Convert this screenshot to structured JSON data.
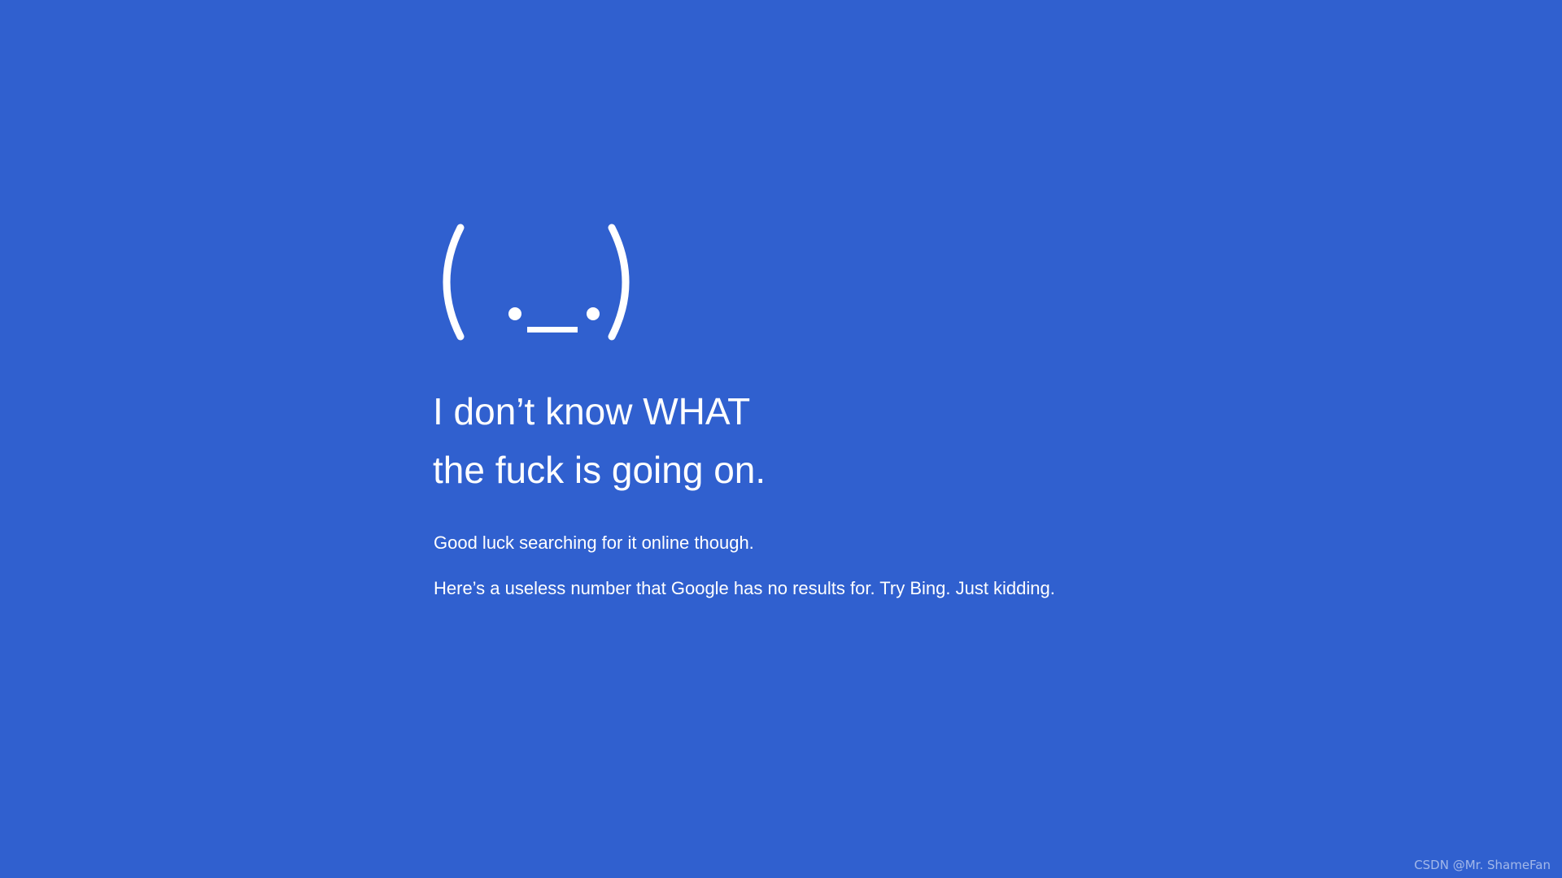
{
  "screen": {
    "background_color": "#3060cf",
    "text_color": "#ffffff"
  },
  "emoticon": {
    "icon": "sad-face-emoticon",
    "text": "( ._.)"
  },
  "headline": {
    "line1": "I don’t know WHAT",
    "line2": "the fuck is going on."
  },
  "info": {
    "line1": "Good luck searching for it online though.",
    "line2": "Here’s a useless number that Google has no results for. Try Bing. Just kidding."
  },
  "watermark": {
    "text": "CSDN @Mr. ShameFan"
  }
}
